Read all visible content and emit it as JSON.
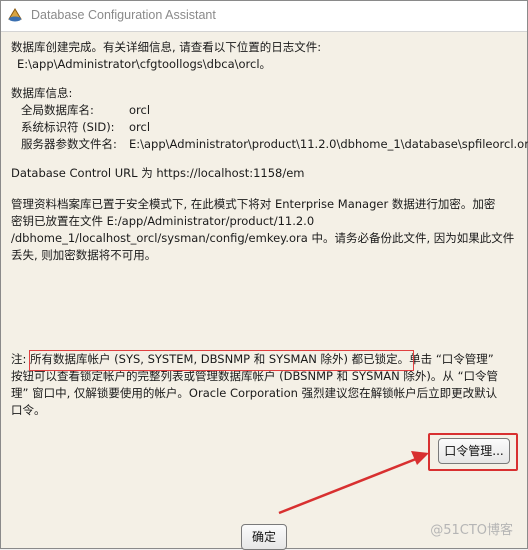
{
  "window": {
    "title": "Database Configuration Assistant",
    "icon": "dbca-app-icon"
  },
  "messages": {
    "complete_line1": "数据库创建完成。有关详细信息, 请查看以下位置的日志文件:",
    "log_path": "E:\\app\\Administrator\\cfgtoollogs\\dbca\\orcl。",
    "db_info_heading": "数据库信息:",
    "db_info": [
      {
        "label": "全局数据库名:",
        "value": "orcl"
      },
      {
        "label": "系统标识符 (SID):",
        "value": "orcl"
      },
      {
        "label": "服务器参数文件名:",
        "value": "E:\\app\\Administrator\\product\\11.2.0\\dbhome_1\\database\\spfileorcl.ora"
      }
    ],
    "control_url": "Database Control URL 为 https://localhost:1158/em",
    "repo_lines": [
      "管理资料档案库已置于安全模式下, 在此模式下将对 Enterprise Manager 数据进行加密。加密",
      "密钥已放置在文件 E:/app/Administrator/product/11.2.0",
      "/dbhome_1/localhost_orcl/sysman/config/emkey.ora 中。请务必备份此文件, 因为如果此文件",
      "丢失, 则加密数据将不可用。"
    ],
    "note_lines": [
      "注: 所有数据库帐户 (SYS, SYSTEM, DBSNMP 和 SYSMAN 除外) 都已锁定。单击 “口令管理”",
      "按钮可以查看锁定帐户的完整列表或管理数据库帐户 (DBSNMP 和 SYSMAN 除外)。从 “口令管",
      "理” 窗口中, 仅解锁要使用的帐户。Oracle Corporation 强烈建议您在解锁帐户后立即更改默认",
      "口令。"
    ]
  },
  "buttons": {
    "password_mgmt": "口令管理...",
    "ok": "确定"
  },
  "watermark": "@51CTO博客",
  "colors": {
    "highlight": "#e04040",
    "background": "#f4f0e6"
  }
}
